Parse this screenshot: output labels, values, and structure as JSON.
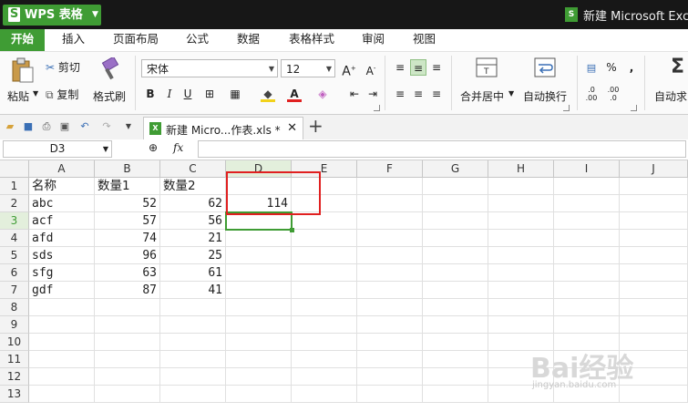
{
  "app": {
    "name": "WPS 表格",
    "logo_letter": "S",
    "doc_title": "新建 Microsoft Exce",
    "doc_icon_letter": "S"
  },
  "menu": [
    "开始",
    "插入",
    "页面布局",
    "公式",
    "数据",
    "表格样式",
    "审阅",
    "视图"
  ],
  "ribbon": {
    "paste": "粘贴",
    "cut": "剪切",
    "copy": "复制",
    "format_painter": "格式刷",
    "font_name": "宋体",
    "font_size": "12",
    "bold": "B",
    "italic": "I",
    "underline": "U",
    "grow_font": "A",
    "shrink_font": "A",
    "merge_center": "合并居中",
    "wrap_text": "自动换行",
    "autosum": "自动求",
    "percent": "%",
    "comma": ","
  },
  "tabs": [
    {
      "label": "新建 Micro...作表.xls *"
    }
  ],
  "formula_bar": {
    "name_box": "D3",
    "fx": "fx",
    "value": ""
  },
  "columns": [
    "A",
    "B",
    "C",
    "D",
    "E",
    "F",
    "G",
    "H",
    "I",
    "J"
  ],
  "rows": [
    "1",
    "2",
    "3",
    "4",
    "5",
    "6",
    "7",
    "8",
    "9",
    "10",
    "11",
    "12",
    "13"
  ],
  "active_cell": "D3",
  "sheet": {
    "header": [
      "名称",
      "数量1",
      "数量2"
    ],
    "data": [
      {
        "name": "abc",
        "q1": "52",
        "q2": "62"
      },
      {
        "name": "acf",
        "q1": "57",
        "q2": "56"
      },
      {
        "name": "afd",
        "q1": "74",
        "q2": "21"
      },
      {
        "name": "sds",
        "q1": "96",
        "q2": "25"
      },
      {
        "name": "sfg",
        "q1": "63",
        "q2": "61"
      },
      {
        "name": "gdf",
        "q1": "87",
        "q2": "41"
      }
    ],
    "d2_value": "114"
  },
  "watermark": {
    "main": "Bai经验",
    "sub": "jingyan.baidu.com"
  }
}
